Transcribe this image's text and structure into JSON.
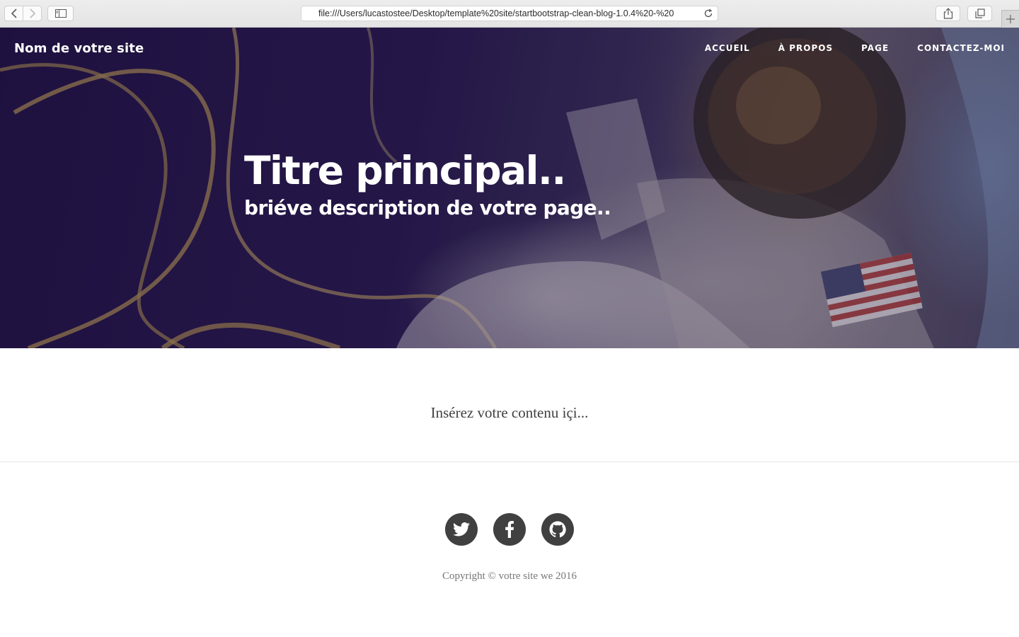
{
  "browser": {
    "url": "file:///Users/lucastostee/Desktop/template%20site/startbootstrap-clean-blog-1.0.4%20-%20"
  },
  "navbar": {
    "brand": "Nom de votre site",
    "links": [
      "ACCUEIL",
      "À PROPOS",
      "PAGE",
      "CONTACTEZ-MOI"
    ]
  },
  "hero": {
    "title": "Titre principal..",
    "subtitle": "briéve description de votre page.."
  },
  "main": {
    "content": "Insérez votre contenu içi..."
  },
  "footer": {
    "social": [
      "twitter-icon",
      "facebook-icon",
      "github-icon"
    ],
    "copyright": "Copyright © votre site we 2016"
  },
  "colors": {
    "hero_purple": "#231347",
    "text_dark": "#404040",
    "text_muted": "#777777",
    "social_bg": "#404040"
  }
}
